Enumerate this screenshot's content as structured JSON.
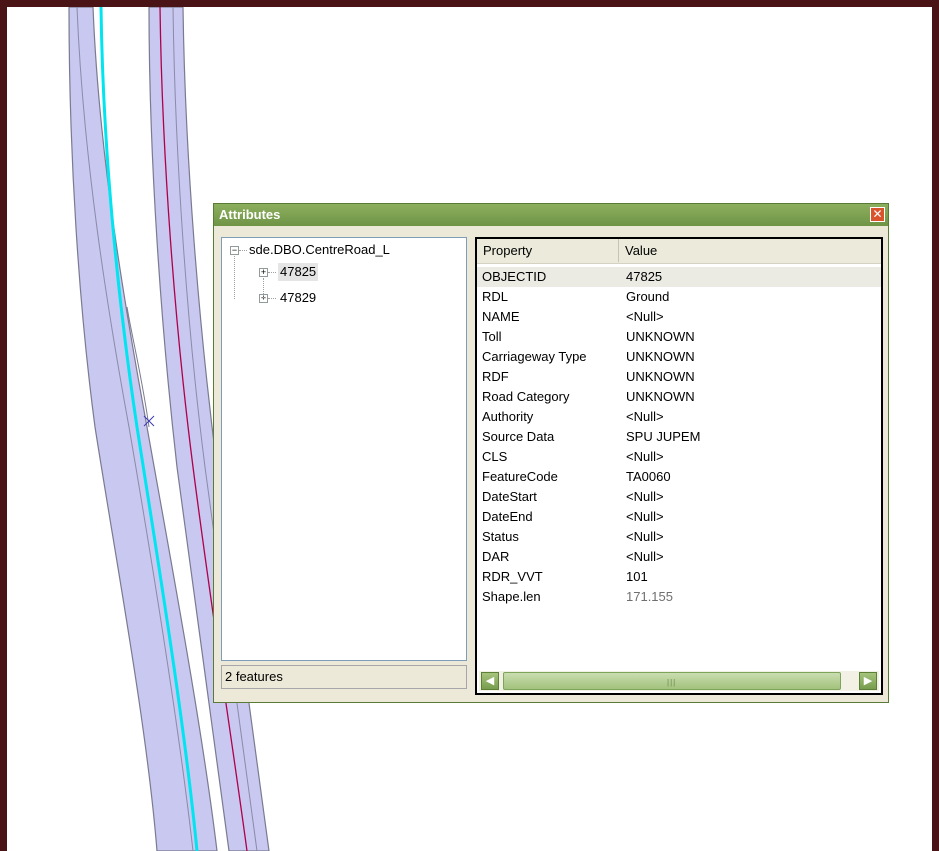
{
  "window": {
    "title": "Attributes",
    "close_glyph": "✕"
  },
  "tree": {
    "root_label": "sde.DBO.CentreRoad_L",
    "items": [
      {
        "label": "47825",
        "selected": true
      },
      {
        "label": "47829",
        "selected": false
      }
    ],
    "expander_collapsed": "+",
    "expander_expanded": "−"
  },
  "status": {
    "text": "2 features"
  },
  "grid": {
    "col_property": "Property",
    "col_value": "Value",
    "rows": [
      {
        "property": "OBJECTID",
        "value": "47825"
      },
      {
        "property": "RDL",
        "value": "Ground"
      },
      {
        "property": "NAME",
        "value": "<Null>"
      },
      {
        "property": "Toll",
        "value": "UNKNOWN"
      },
      {
        "property": "Carriageway Type",
        "value": "UNKNOWN"
      },
      {
        "property": "RDF",
        "value": "UNKNOWN"
      },
      {
        "property": "Road Category",
        "value": "UNKNOWN"
      },
      {
        "property": "Authority",
        "value": "<Null>"
      },
      {
        "property": "Source Data",
        "value": "SPU JUPEM"
      },
      {
        "property": "CLS",
        "value": "<Null>"
      },
      {
        "property": "FeatureCode",
        "value": "TA0060"
      },
      {
        "property": "DateStart",
        "value": "<Null>"
      },
      {
        "property": "DateEnd",
        "value": "<Null>"
      },
      {
        "property": "Status",
        "value": "<Null>"
      },
      {
        "property": "DAR",
        "value": "<Null>"
      },
      {
        "property": "RDR_VVT",
        "value": "101"
      },
      {
        "property": "Shape.len",
        "value": "171.155"
      }
    ]
  },
  "scrollbar": {
    "left_glyph": "◀",
    "right_glyph": "▶",
    "grip": "|||"
  },
  "colors": {
    "road_fill": "#c8c8f0",
    "road_outline": "#7a7a90",
    "centerline_cyan": "#00e5f0",
    "centerline_red": "#b0004a",
    "frame": "#4a1416",
    "title_green": "#7a9c50"
  }
}
